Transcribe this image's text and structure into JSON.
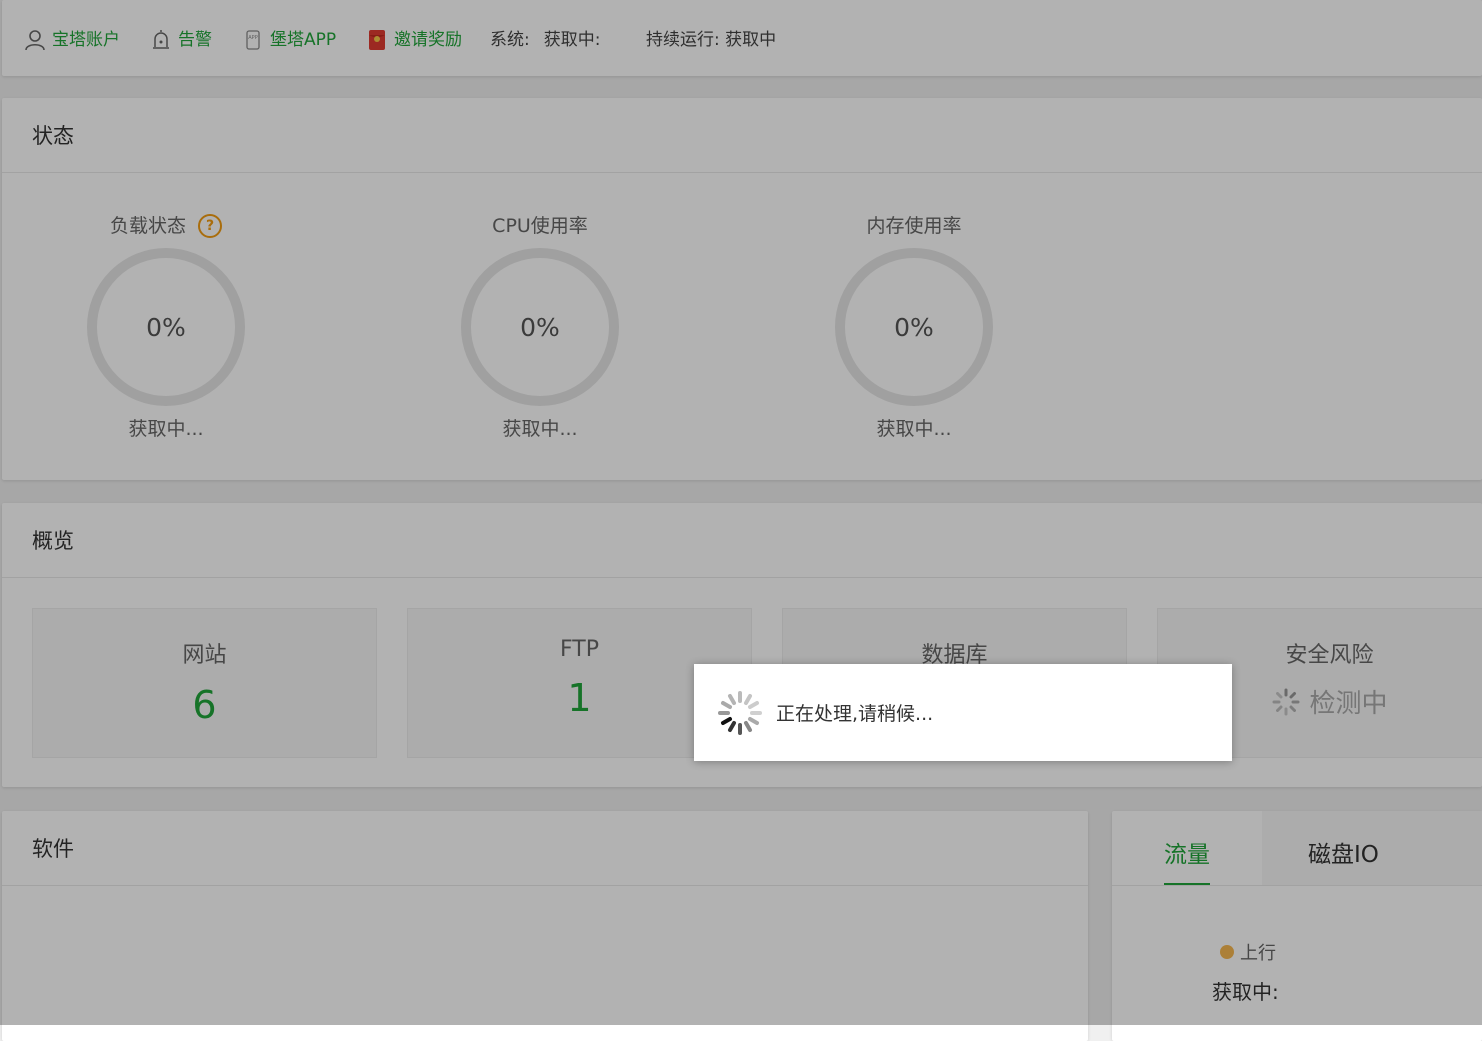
{
  "topbar": {
    "account_label": "宝塔账户",
    "alert_label": "告警",
    "app_label": "堡塔APP",
    "invite_label": "邀请奖励",
    "system_label": "系统:",
    "system_value": "获取中:",
    "uptime_label": "持续运行: 获取中"
  },
  "status": {
    "title": "状态",
    "gauges": [
      {
        "label": "负载状态",
        "value": "0%",
        "sub": "获取中..."
      },
      {
        "label": "CPU使用率",
        "value": "0%",
        "sub": "获取中..."
      },
      {
        "label": "内存使用率",
        "value": "0%",
        "sub": "获取中..."
      }
    ],
    "help_symbol": "?"
  },
  "overview": {
    "title": "概览",
    "items": [
      {
        "label": "网站",
        "value": "6"
      },
      {
        "label": "FTP",
        "value": "1"
      },
      {
        "label": "数据库",
        "value": ""
      },
      {
        "label": "安全风险",
        "value": "检测中"
      }
    ]
  },
  "software": {
    "title": "软件"
  },
  "traffic": {
    "tabs": [
      "流量",
      "磁盘IO"
    ],
    "legend_up": "上行",
    "up_value": "获取中:"
  },
  "loading": {
    "message": "正在处理,请稍候..."
  },
  "colors": {
    "accent": "#20a53a",
    "warning": "#f39c12",
    "legend_up": "#f7b851"
  },
  "icons": {
    "account": "user-icon",
    "alert": "alarm-icon",
    "app": "app-icon",
    "invite": "red-envelope-icon",
    "spinner": "loading-spinner-icon"
  }
}
